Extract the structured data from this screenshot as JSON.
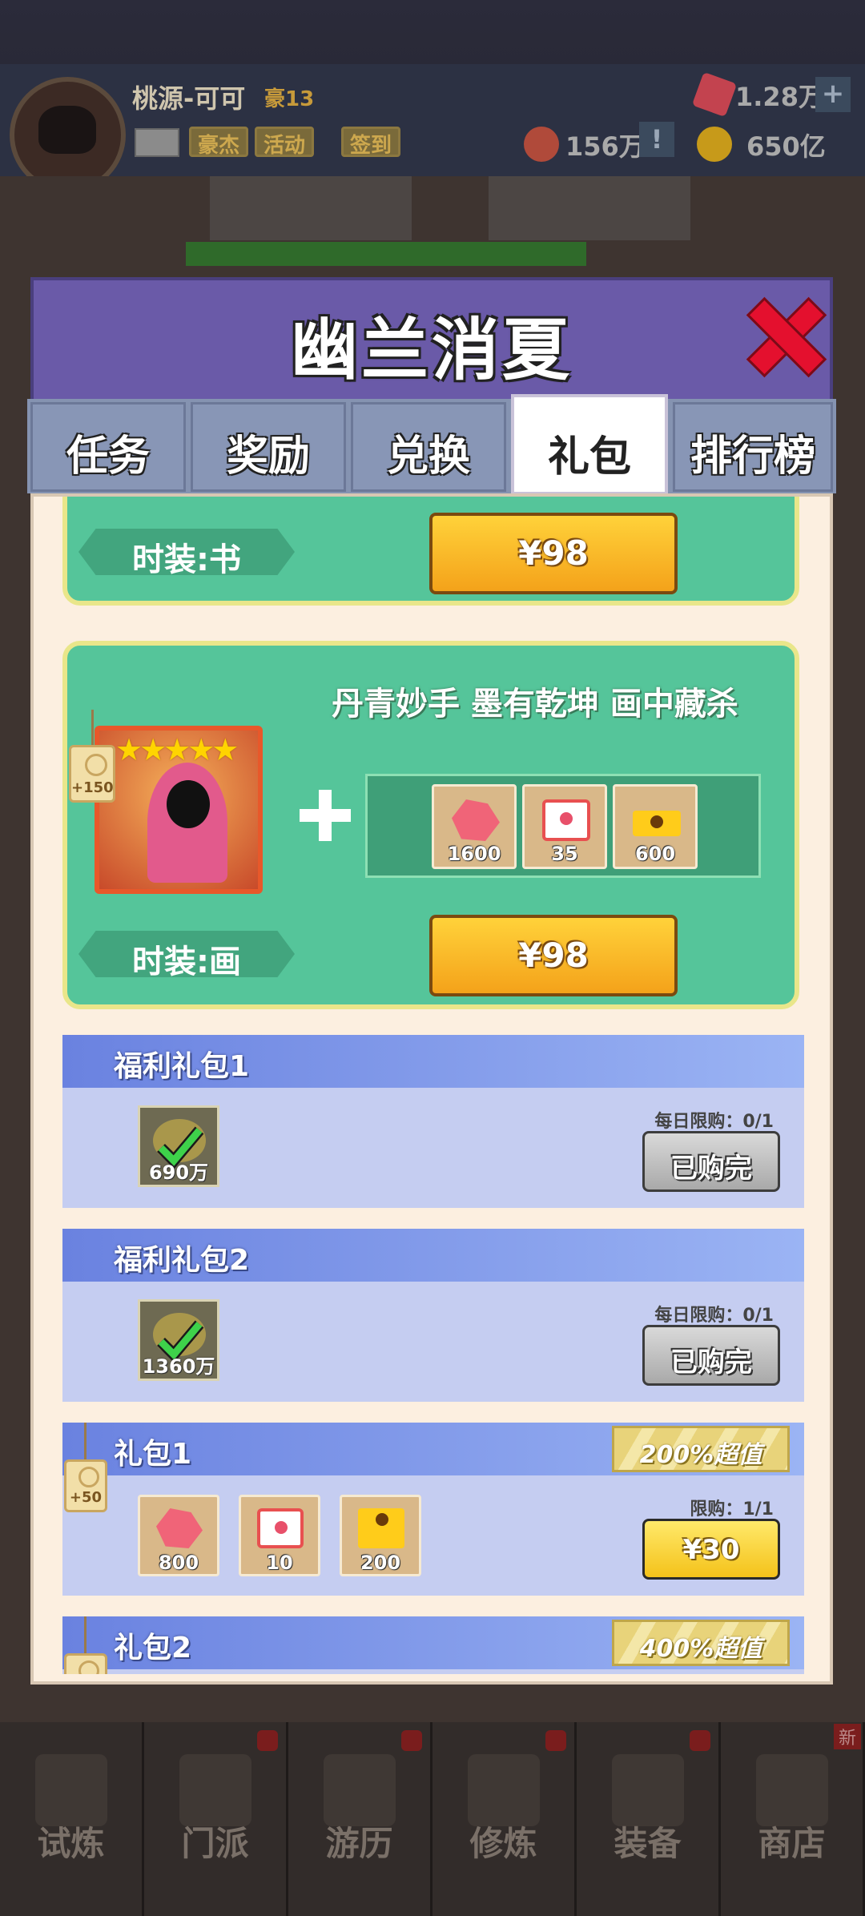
{
  "hud": {
    "player_name": "桃源-可可",
    "player_rank": "豪13",
    "buttons": [
      "豪杰",
      "活动",
      "签到"
    ],
    "gems": "1.28万",
    "tokens": "156万",
    "gold": "650亿",
    "plus": "+",
    "notice": "!"
  },
  "modal": {
    "title": "幽兰消夏",
    "tabs": [
      "任务",
      "奖励",
      "兑换",
      "礼包",
      "排行榜"
    ],
    "active_tab": "礼包"
  },
  "fashion_cards": [
    {
      "label": "时装:书",
      "price": "¥98"
    },
    {
      "slogan": "丹青妙手 墨有乾坤 画中藏杀",
      "tag": "+150",
      "stars": "★★★★★",
      "rewards": [
        {
          "icon": "gem-icon",
          "count": "1600"
        },
        {
          "icon": "ticket-icon",
          "count": "35"
        },
        {
          "icon": "gold-ingot-icon",
          "count": "600"
        }
      ],
      "label": "时装:画",
      "price": "¥98"
    }
  ],
  "packs": [
    {
      "title": "福利礼包1",
      "limit": "每日限购：0/1",
      "item_count": "690万",
      "status": "已购完"
    },
    {
      "title": "福利礼包2",
      "limit": "每日限购：0/1",
      "item_count": "1360万",
      "status": "已购完"
    },
    {
      "title": "礼包1",
      "tag": "+50",
      "badge": "200%超值",
      "limit": "限购：1/1",
      "price": "¥30",
      "items": [
        {
          "icon": "gem-icon",
          "count": "800"
        },
        {
          "icon": "ticket-icon",
          "count": "10"
        },
        {
          "icon": "gold-ingot-icon",
          "count": "200"
        }
      ]
    },
    {
      "title": "礼包2",
      "badge": "400%超值"
    }
  ],
  "bottom_nav": {
    "items": [
      "试炼",
      "门派",
      "游历",
      "修炼",
      "装备",
      "商店"
    ],
    "new_badge": "新"
  },
  "colors": {
    "header": "#6a5aa8",
    "card_green": "#55c59a",
    "price_yellow": "#f4a21a",
    "pack_blue": "#c5cdf1",
    "close_red": "#e4102e"
  }
}
